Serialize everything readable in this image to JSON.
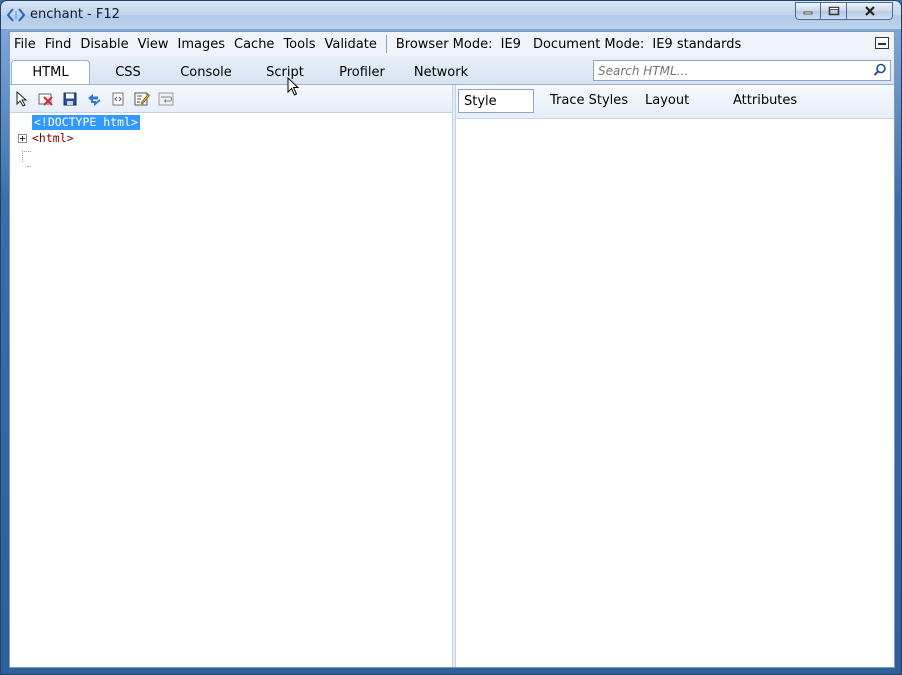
{
  "window": {
    "title": "enchant - F12",
    "buttons": {
      "minimize": "minimize",
      "maximize": "maximize",
      "close": "close"
    }
  },
  "menubar": {
    "items": [
      "File",
      "Find",
      "Disable",
      "View",
      "Images",
      "Cache",
      "Tools",
      "Validate"
    ],
    "browser_mode_label": "Browser Mode:",
    "browser_mode_value": "IE9",
    "document_mode_label": "Document Mode:",
    "document_mode_value": "IE9 standards"
  },
  "tabs": {
    "items": [
      "HTML",
      "CSS",
      "Console",
      "Script",
      "Profiler",
      "Network"
    ],
    "active": "HTML"
  },
  "search": {
    "placeholder": "Search HTML..."
  },
  "html_toolbar": {
    "icons": [
      "select-element-icon",
      "clear-highlight-icon",
      "save-icon",
      "refresh-icon",
      "view-source-icon",
      "edit-icon",
      "word-wrap-icon"
    ]
  },
  "dom_tree": {
    "nodes": [
      {
        "text": "<!DOCTYPE html>",
        "selected": true
      },
      {
        "text": "<html>",
        "selected": false,
        "collapsed": true
      }
    ]
  },
  "right_tabs": {
    "items": [
      "Style",
      "Trace Styles",
      "Layout",
      "Attributes"
    ],
    "active": "Style"
  },
  "colors": {
    "selection": "#3399ff",
    "tag_text": "#8b0000",
    "frame": "#3c6ea8"
  }
}
